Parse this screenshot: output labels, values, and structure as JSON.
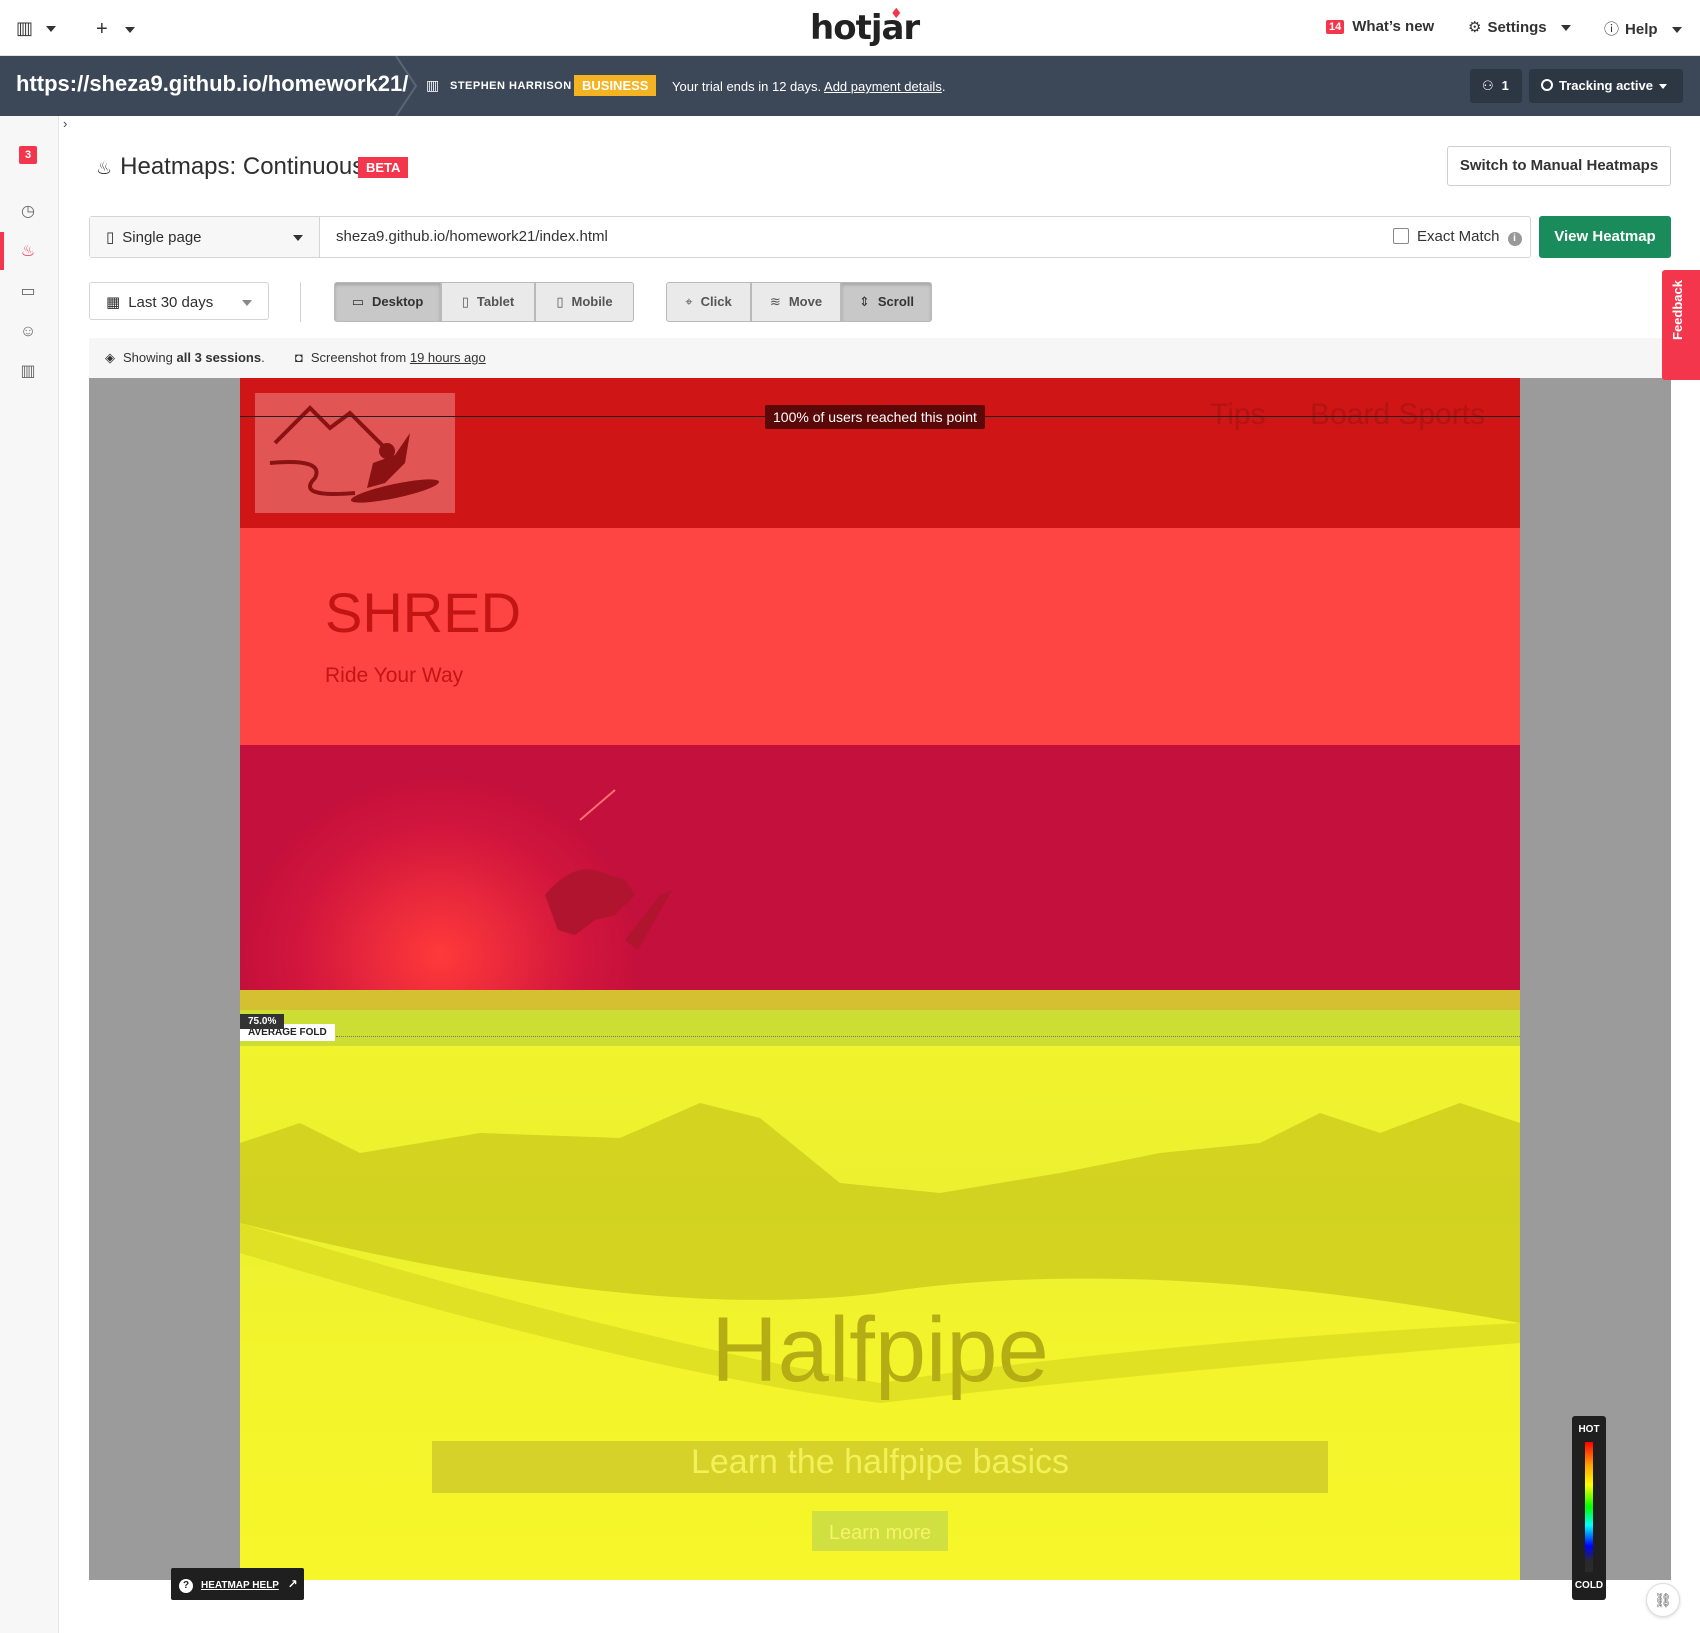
{
  "topbar": {
    "org_icon": "building-icon",
    "add_icon": "plus-icon",
    "logo": "hotjar",
    "whats_new_count": "14",
    "whats_new_label": "What’s new",
    "settings_label": "Settings",
    "help_label": "Help"
  },
  "sitebar": {
    "site_url": "https://sheza9.github.io/homework21/",
    "org_name": "STEPHEN HARRISON",
    "plan": "BUSINESS",
    "trial_text": "Your trial ends in 12 days.",
    "trial_link": "Add payment details",
    "users_count": "1",
    "tracking_label": "Tracking active"
  },
  "rail": {
    "badge": "3",
    "items": [
      "dashboard-icon",
      "heatmaps-icon",
      "recordings-icon",
      "feedback-icon",
      "reports-icon"
    ]
  },
  "header": {
    "title": "Heatmaps: Continuous",
    "beta": "BETA",
    "switch_button": "Switch to Manual Heatmaps"
  },
  "url_row": {
    "page_type": "Single page",
    "url": "sheza9.github.io/homework21/index.html",
    "exact_match_label": "Exact Match",
    "exact_match_checked": false,
    "view_button": "View Heatmap"
  },
  "filters": {
    "date_range": "Last 30 days",
    "devices": [
      {
        "label": "Desktop",
        "active": true
      },
      {
        "label": "Tablet",
        "active": false
      },
      {
        "label": "Mobile",
        "active": false
      }
    ],
    "types": [
      {
        "label": "Click",
        "active": false
      },
      {
        "label": "Move",
        "active": false
      },
      {
        "label": "Scroll",
        "active": true
      }
    ]
  },
  "info": {
    "showing_prefix": "Showing",
    "showing_bold": "all 3 sessions",
    "showing_suffix": ".",
    "screenshot_prefix": "Screenshot from",
    "screenshot_link": "19 hours ago"
  },
  "heatmap": {
    "reach_label": "100% of users reached this point",
    "nav_links": [
      "Tips",
      "Board Sports"
    ],
    "hero_title": "SHRED",
    "hero_subtitle": "Ride Your Way",
    "fold_percent": "75.0%",
    "fold_label": "AVERAGE FOLD",
    "halfpipe_title": "Halfpipe",
    "halfpipe_subtitle": "Learn the halfpipe basics",
    "learn_more": "Learn more",
    "band_colors": [
      "#cf1515",
      "#ff4444",
      "#c4103c",
      "#d4c030",
      "#ccde34",
      "#f1f32c"
    ]
  },
  "legend": {
    "hot": "HOT",
    "cold": "COLD"
  },
  "help_badge": "HEATMAP HELP",
  "feedback_tab": "Feedback"
}
